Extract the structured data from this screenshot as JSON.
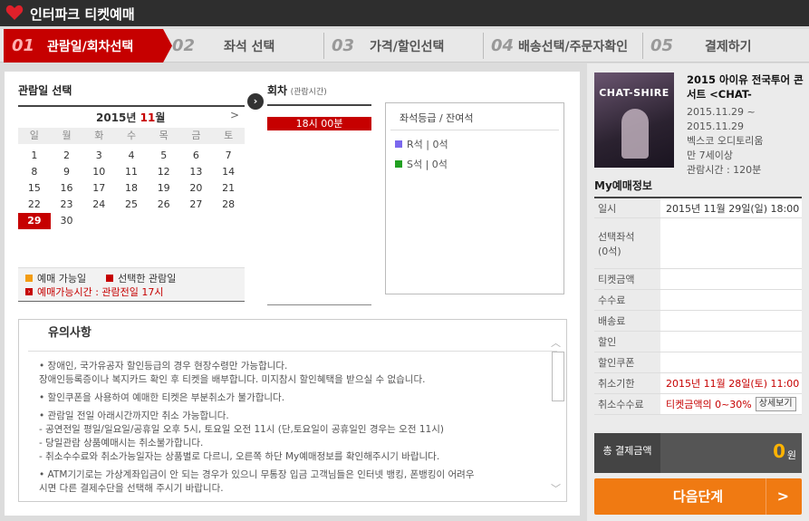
{
  "app": {
    "title": "인터파크 티켓예매"
  },
  "steps": [
    {
      "num": "01",
      "label": "관람일/회차선택"
    },
    {
      "num": "02",
      "label": "좌석 선택"
    },
    {
      "num": "03",
      "label": "가격/할인선택"
    },
    {
      "num": "04",
      "label": "배송선택/주문자확인"
    },
    {
      "num": "05",
      "label": "결제하기"
    }
  ],
  "calendar": {
    "title": "관람일 선택",
    "year": "2015",
    "year_suffix": "년",
    "month": "11",
    "month_suffix": "월",
    "next_label": ">",
    "weekdays": [
      "일",
      "월",
      "화",
      "수",
      "목",
      "금",
      "토"
    ],
    "days": [
      "1",
      "2",
      "3",
      "4",
      "5",
      "6",
      "7",
      "8",
      "9",
      "10",
      "11",
      "12",
      "13",
      "14",
      "15",
      "16",
      "17",
      "18",
      "19",
      "20",
      "21",
      "22",
      "23",
      "24",
      "25",
      "26",
      "27",
      "28",
      "29",
      "30"
    ],
    "selected_day": "29",
    "legend_available": "예매 가능일",
    "legend_selected": "선택한 관람일",
    "legend_time": "예매가능시간 : 관람전일 17시"
  },
  "round": {
    "title": "회차",
    "subtitle": "(관람시간)",
    "slot": "18시 00분"
  },
  "seats": {
    "title": "좌석등급 / 잔여석",
    "items": [
      {
        "label": "R석 | 0석",
        "color": "#7b68ee"
      },
      {
        "label": "S석 | 0석",
        "color": "#22a022"
      }
    ]
  },
  "notice": {
    "title": "유의사항",
    "items": [
      "• 장애인, 국가유공자 할인등급의 경우 현장수령만 가능합니다.\n  장애인등록증이나 복지카드 확인 후 티켓을 배부합니다. 미지참시 할인혜택을 받으실 수 없습니다.",
      "• 할인쿠폰을 사용하여 예매한 티켓은 부분취소가 불가합니다.",
      "• 관람일 전일 아래시간까지만 취소 가능합니다.\n  - 공연전일 평일/일요일/공휴일 오후 5시, 토요일 오전 11시 (단,토요일이 공휴일인 경우는 오전 11시)\n  - 당일관람 상품예매시는 취소불가합니다.\n  - 취소수수료와 취소가능일자는 상품별로 다르니, 오른쪽 하단 My예매정보를 확인해주시기 바랍니다.",
      "• ATM기기로는 가상계좌입금이 안 되는 경우가 있으니 무통장 입금 고객님들은 인터넷 뱅킹, 폰뱅킹이 어려우\n  시면 다른 결제수단을 선택해 주시기 바랍니다."
    ]
  },
  "show": {
    "poster_text": "CHAT-SHIRE",
    "name": "2015 아이유 전국투어 콘서트 <CHAT-",
    "period": "2015.11.29 ~ 2015.11.29",
    "venue": "벡스코 오디토리움",
    "age": "만 7세이상",
    "runtime": "관람시간 : 120분"
  },
  "my": {
    "title": "My예매정보",
    "rows": [
      {
        "k": "일시",
        "v": "2015년 11월 29일(일) 18:00"
      },
      {
        "k": "선택좌석\n(0석)",
        "v": ""
      },
      {
        "k": "티켓금액",
        "v": ""
      },
      {
        "k": "수수료",
        "v": ""
      },
      {
        "k": "배송료",
        "v": ""
      },
      {
        "k": "할인",
        "v": ""
      },
      {
        "k": "할인쿠폰",
        "v": ""
      },
      {
        "k": "취소기한",
        "v": "2015년 11월 28일(토) 11:00"
      },
      {
        "k": "취소수수료",
        "v": "티켓금액의 0~30%"
      }
    ],
    "detail_btn": "상세보기",
    "total_label": "총 결제금액",
    "total_value": "0",
    "total_unit": "원",
    "next_btn": "다음단계",
    "next_chevron": ">"
  }
}
